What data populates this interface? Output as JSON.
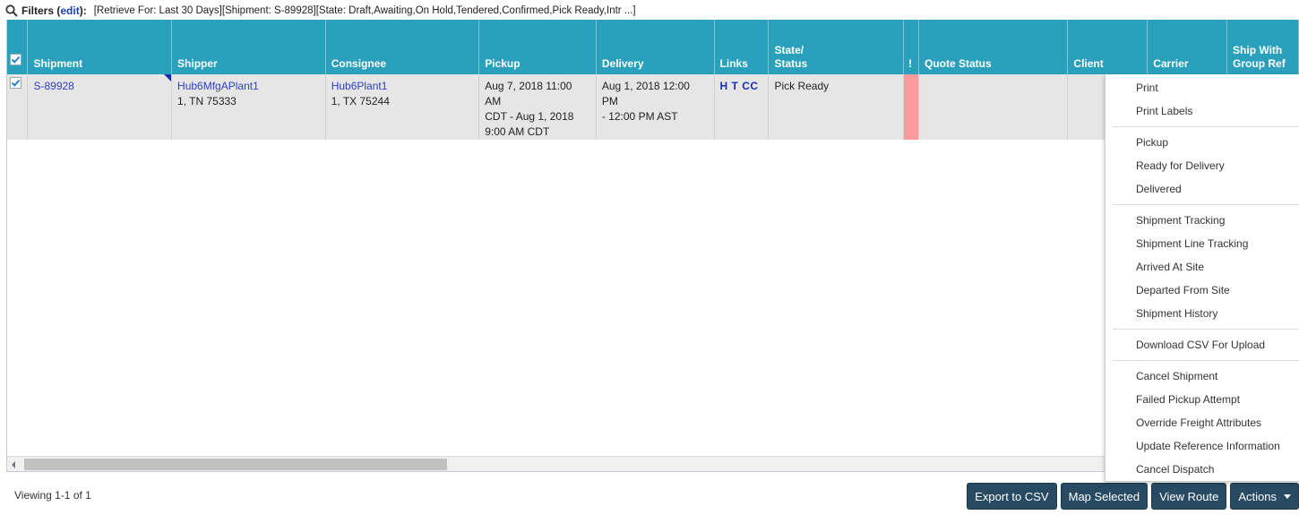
{
  "filters": {
    "icon": "search-icon",
    "label": "Filters",
    "edit_open": "(",
    "edit_label": "edit",
    "edit_close": "):",
    "value": "[Retrieve For: Last 30 Days][Shipment: S-89928][State: Draft,Awaiting,On Hold,Tendered,Confirmed,Pick Ready,Intr ...]"
  },
  "table": {
    "columns": {
      "shipment": "Shipment",
      "shipper": "Shipper",
      "consignee": "Consignee",
      "pickup": "Pickup",
      "delivery": "Delivery",
      "links": "Links",
      "state_1": "State/",
      "state_2": "Status",
      "alert": "!",
      "quote_status": "Quote Status",
      "client": "Client",
      "carrier": "Carrier",
      "ship_with_1": "Ship With",
      "ship_with_2": "Group Ref"
    },
    "header_checkbox_checked": true,
    "rows": [
      {
        "checked": true,
        "shipment": "S-89928",
        "shipper_name": "Hub6MfgAPlant1",
        "shipper_addr": "1, TN 75333",
        "consignee_name": "Hub6Plant1",
        "consignee_addr": "1, TX 75244",
        "pickup_1": "Aug 7, 2018 11:00 AM",
        "pickup_2": "CDT - Aug 1, 2018",
        "pickup_3": "9:00 AM CDT",
        "delivery_1": "Aug 1, 2018 12:00 PM",
        "delivery_2": "- 12:00 PM AST",
        "links": "H T CC",
        "status": "Pick Ready",
        "quote_status": "",
        "client": "",
        "carrier": "",
        "ship_with_group_ref": ""
      }
    ]
  },
  "footer": {
    "viewing": "Viewing 1-1 of 1",
    "buttons": {
      "export": "Export to CSV",
      "map": "Map Selected",
      "route": "View Route",
      "actions": "Actions"
    }
  },
  "actions_menu": {
    "groups": [
      [
        "Print",
        "Print Labels"
      ],
      [
        "Pickup",
        "Ready for Delivery",
        "Delivered"
      ],
      [
        "Shipment Tracking",
        "Shipment Line Tracking",
        "Arrived At Site",
        "Departed From Site",
        "Shipment History"
      ],
      [
        "Download CSV For Upload"
      ],
      [
        "Cancel Shipment",
        "Failed Pickup Attempt",
        "Override Freight Attributes",
        "Update Reference Information",
        "Cancel Dispatch"
      ]
    ]
  },
  "colors": {
    "header_bg": "#2aa0bd",
    "alert_cell": "#fb9a9a",
    "button_bg": "#284b63",
    "link": "#2e3fbf"
  }
}
